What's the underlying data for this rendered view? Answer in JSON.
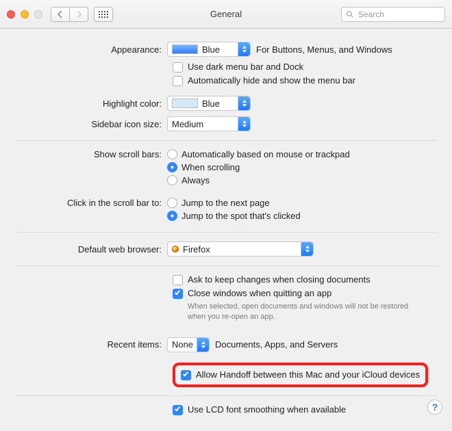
{
  "window": {
    "title": "General"
  },
  "toolbar": {
    "search_placeholder": "Search"
  },
  "labels": {
    "appearance": "Appearance:",
    "highlight": "Highlight color:",
    "sidebar": "Sidebar icon size:",
    "scrollbars": "Show scroll bars:",
    "clickscroll": "Click in the scroll bar to:",
    "browser": "Default web browser:",
    "recent": "Recent items:"
  },
  "appearance": {
    "value": "Blue",
    "hint": "For Buttons, Menus, and Windows",
    "dark_menu": "Use dark menu bar and Dock",
    "autohide": "Automatically hide and show the menu bar"
  },
  "highlight": {
    "value": "Blue"
  },
  "sidebar": {
    "value": "Medium"
  },
  "scrollbars": {
    "auto": "Automatically based on mouse or trackpad",
    "when": "When scrolling",
    "always": "Always"
  },
  "clickscroll": {
    "next": "Jump to the next page",
    "spot": "Jump to the spot that's clicked"
  },
  "browser": {
    "value": "Firefox"
  },
  "documents": {
    "ask": "Ask to keep changes when closing documents",
    "close": "Close windows when quitting an app",
    "close_hint": "When selected, open documents and windows will not be restored when you re-open an app."
  },
  "recent": {
    "value": "None",
    "suffix": "Documents, Apps, and Servers"
  },
  "handoff": {
    "label": "Allow Handoff between this Mac and your iCloud devices"
  },
  "lcd": {
    "label": "Use LCD font smoothing when available"
  },
  "help": {
    "label": "?"
  }
}
